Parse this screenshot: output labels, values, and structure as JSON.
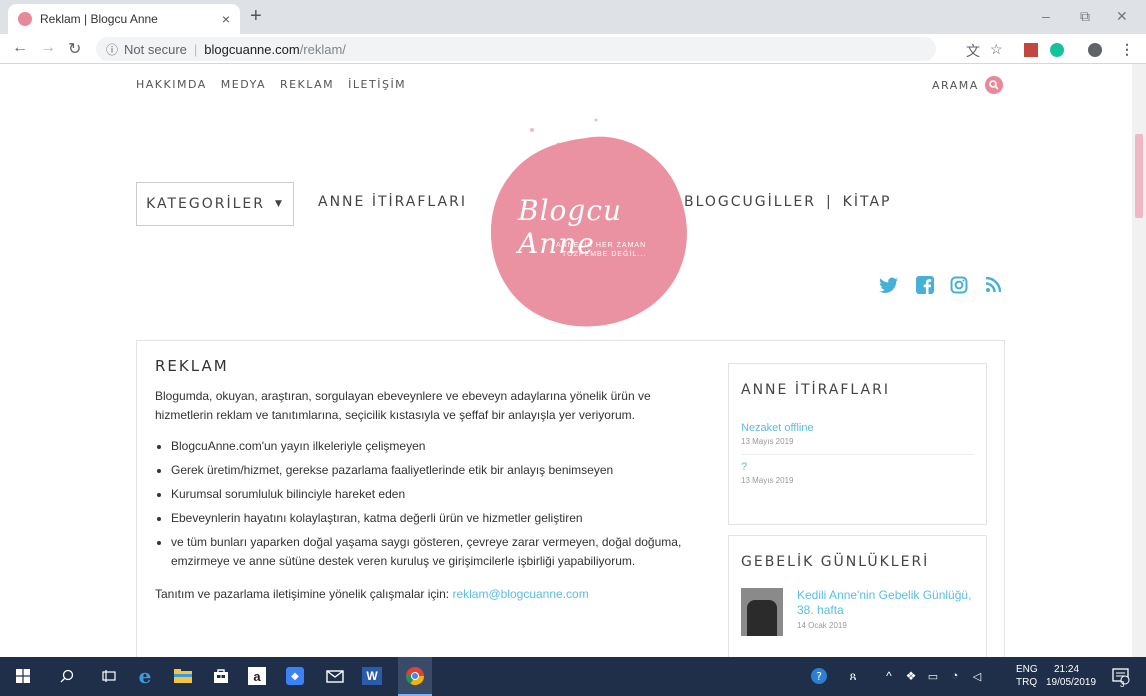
{
  "browser": {
    "tab_title": "Reklam | Blogcu Anne",
    "tab_close": "×",
    "new_tab": "+",
    "url_info": "ⓘ",
    "url_secure": "Not secure",
    "url_sep": "|",
    "url_host": "blogcuanne.com",
    "url_path": "/reklam/",
    "win_min": "–",
    "win_restore": "⧉",
    "win_close": "✕"
  },
  "topnav": {
    "items": [
      "HAKKIMDA",
      "MEDYA",
      "REKLAM",
      "İLETİŞİM"
    ],
    "search_label": "ARAMA"
  },
  "logo": {
    "script": "Blogcu Anne",
    "tagline1": "ANNELİK HER ZAMAN",
    "tagline2": "TOZPEMBE DEĞİL..."
  },
  "mainnav": {
    "categories_label": "KATEGORİLER",
    "anne_label": "ANNE İTİRAFLARI",
    "blogcugiller_label": "BLOGCUGİLLER",
    "separator": "|",
    "kitap_label": "KİTAP"
  },
  "social": {
    "icons": [
      "twitter-icon",
      "facebook-icon",
      "instagram-icon",
      "rss-icon"
    ]
  },
  "article": {
    "title": "REKLAM",
    "intro": "Blogumda, okuyan, araştıran, sorgulayan ebeveynlere ve ebeveyn adaylarına yönelik ürün ve hizmetlerin reklam ve tanıtımlarına, seçicilik kıstasıyla ve şeffaf bir anlayışla yer veriyorum.",
    "bullets": [
      "BlogcuAnne.com'un yayın ilkeleriyle çelişmeyen",
      "Gerek üretim/hizmet, gerekse pazarlama faaliyetlerinde etik bir anlayış benimseyen",
      "Kurumsal sorumluluk bilinciyle hareket eden",
      "Ebeveynlerin hayatını kolaylaştıran, katma değerli ürün ve hizmetler geliştiren",
      "ve tüm bunları yaparken doğal yaşama saygı gösteren, çevreye zarar vermeyen, doğal doğuma, emzirmeye ve anne sütüne destek veren kuruluş ve girişimcilerle işbirliği yapabiliyorum."
    ],
    "contact_text": "Tanıtım ve pazarlama iletişimine yönelik çalışmalar için:",
    "contact_email": "reklam@blogcuanne.com"
  },
  "sidebar": {
    "anne": {
      "title": "ANNE İTİRAFLARI",
      "posts": [
        {
          "title": "Nezaket offline",
          "date": "13 Mayıs 2019"
        },
        {
          "title": "?",
          "date": "13 Mayıs 2019"
        }
      ]
    },
    "gebelik": {
      "title": "GEBELİK GÜNLÜKLERİ",
      "post_title": "Kedili Anne'nin Gebelik Günlüğü, 38. hafta",
      "post_date": "14 Ocak 2019"
    }
  },
  "taskbar": {
    "lang_top": "ENG",
    "lang_bottom": "TRQ",
    "time": "21:24",
    "date": "19/05/2019",
    "notif_count": "3"
  },
  "colors": {
    "accent_pink": "#e8899a",
    "link_blue": "#5bbde0",
    "social_blue": "#47b0d8",
    "taskbar": "#1f2f4a"
  }
}
